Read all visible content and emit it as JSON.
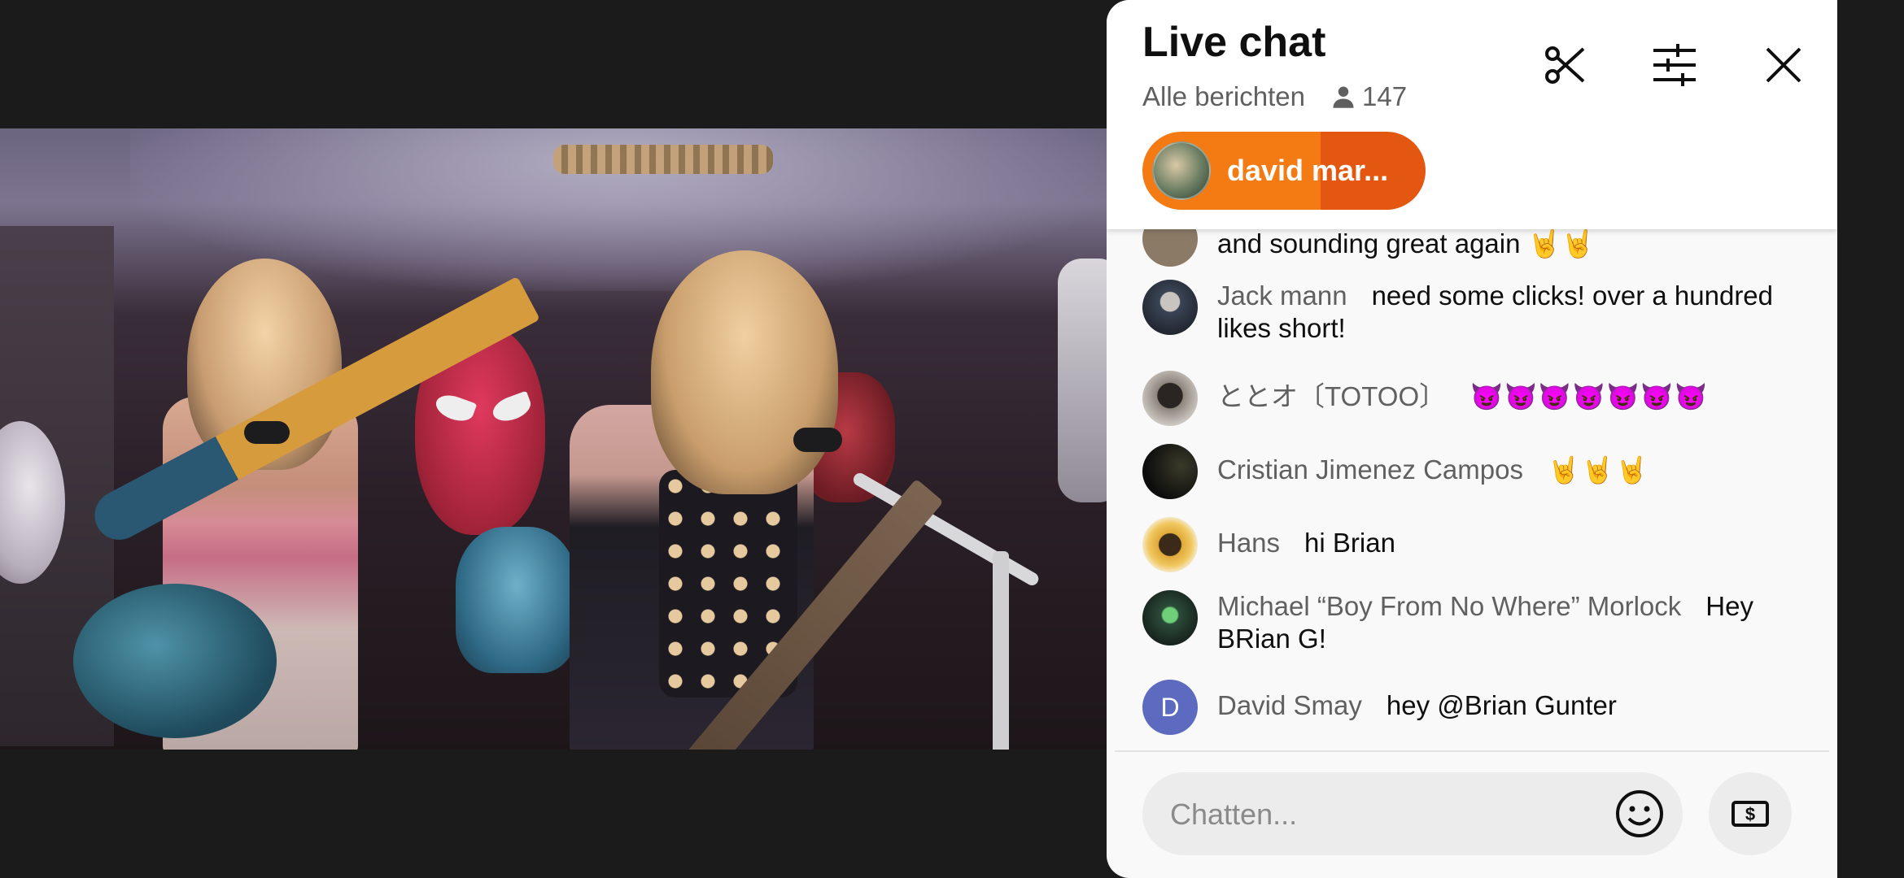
{
  "chat": {
    "title": "Live chat",
    "filter": "Alle berichten",
    "viewer_count": "147",
    "pinned": {
      "name": "david mar..."
    },
    "messages": [
      {
        "author": "",
        "text": "and sounding great again 🤘🤘",
        "avatar_color": "#8a7a66"
      },
      {
        "author": "Jack mann",
        "text": "need some clicks! over a hundred likes short!",
        "avatar_color": "#3a4455"
      },
      {
        "author": "ととオ〔TOTOO〕",
        "text": "😈😈😈😈😈😈😈",
        "avatar_color": "#5c5550"
      },
      {
        "author": "Cristian Jimenez Campos",
        "text": "🤘🤘🤘",
        "avatar_color": "#161616"
      },
      {
        "author": "Hans",
        "text": "hi Brian",
        "avatar_color": "#d9a53a"
      },
      {
        "author": "Michael “Boy From No Where” Morlock",
        "text": "Hey BRian G!",
        "avatar_color": "#2c4b3a"
      },
      {
        "author": "David Smay",
        "text": "hey @Brian Gunter",
        "avatar_letter": "D",
        "avatar_color": "#5c6bc0"
      }
    ],
    "input_placeholder": "Chatten...",
    "icons": {
      "clip": "scissors-icon",
      "filter": "sliders-icon",
      "close": "close-icon",
      "emoji": "smiley-icon",
      "super_chat": "dollar-icon",
      "viewers": "person-icon"
    }
  }
}
